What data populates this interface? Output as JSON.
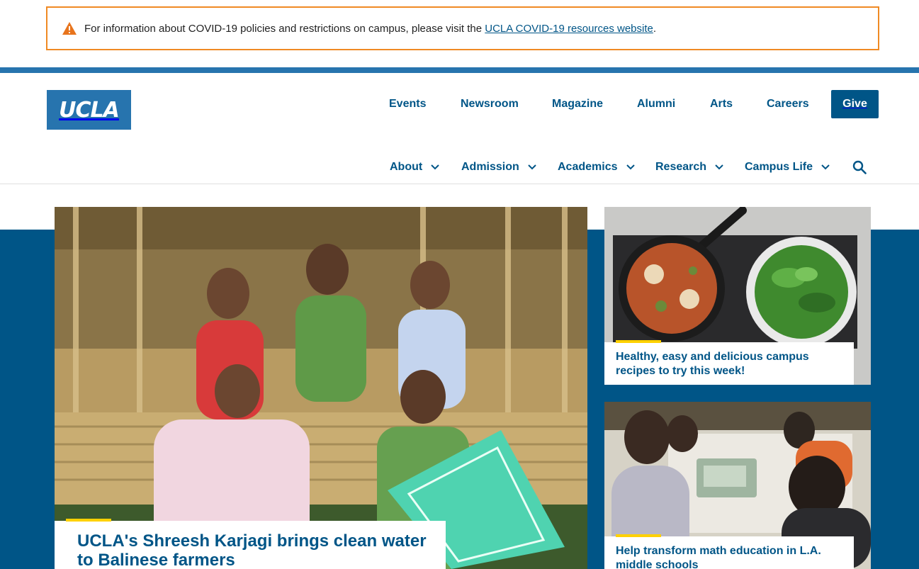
{
  "alert": {
    "icon": "warning-triangle-icon",
    "message": "For information about COVID-19 policies and restrictions on campus, please visit the ",
    "link_text": "UCLA COVID-19 resources website",
    "suffix": "."
  },
  "header": {
    "logo_text": "UCLA",
    "utility_nav": [
      "Events",
      "Newsroom",
      "Magazine",
      "Alumni",
      "Arts",
      "Careers"
    ],
    "give_label": "Give",
    "main_nav": [
      "About",
      "Admission",
      "Academics",
      "Research",
      "Campus Life"
    ],
    "search_icon": "search-icon",
    "dropdown_icon": "chevron-down-icon"
  },
  "stories": {
    "feature": {
      "title": "UCLA's Shreesh Karjagi brings clean water to Balinese farmers"
    },
    "side": [
      {
        "title": "Healthy, easy and delicious campus recipes to try this week!"
      },
      {
        "title": "Help transform math education in L.A. middle schools"
      }
    ]
  },
  "colors": {
    "ucla_blue": "#2774ae",
    "darker_blue": "#005587",
    "ucla_gold": "#ffd100",
    "alert_orange": "#f08a24"
  }
}
